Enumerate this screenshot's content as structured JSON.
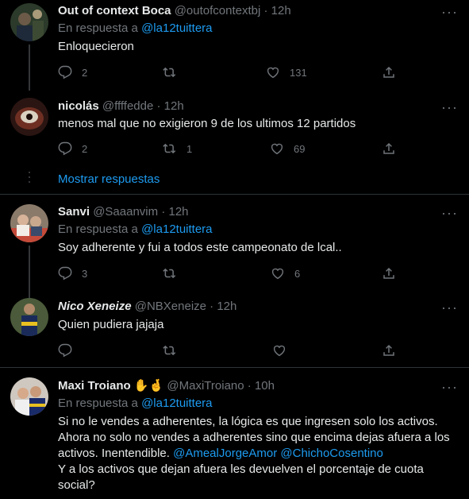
{
  "tweets": [
    {
      "name": "Out of context Boca",
      "handle": "@outofcontextbj",
      "time": "12h",
      "reply_prefix": "En respuesta a",
      "reply_to": "@la12tuittera",
      "text": "Enloquecieron",
      "replies": "2",
      "retweets": "",
      "likes": "131"
    },
    {
      "name": "nicolás",
      "handle": "@ffffedde",
      "time": "12h",
      "text": "menos mal que no exigieron 9 de los ultimos 12 partidos",
      "replies": "2",
      "retweets": "1",
      "likes": "69"
    },
    {
      "name": "Sanvi",
      "handle": "@Saaanvim",
      "time": "12h",
      "reply_prefix": "En respuesta a",
      "reply_to": "@la12tuittera",
      "text": "Soy adherente y fui a todos este campeonato de lcal..",
      "replies": "3",
      "retweets": "",
      "likes": "6"
    },
    {
      "name": "Nico Xeneize",
      "handle": "@NBXeneize",
      "time": "12h",
      "text": "Quien pudiera jajaja",
      "replies": "",
      "retweets": "",
      "likes": ""
    },
    {
      "name": "Maxi Troiano",
      "name_emoji": "✋🤞",
      "handle": "@MaxiTroiano",
      "time": "10h",
      "reply_prefix": "En respuesta a",
      "reply_to": "@la12tuittera",
      "text_line1": "Si no le vendes a adherentes, la lógica es que ingresen solo los activos.",
      "text_line2": "Ahora no solo no vendes a adherentes sino que encima dejas afuera a los",
      "text_line3_prefix": "activos. Inentendible.",
      "mention1": "@AmealJorgeAmor",
      "mention2": "@ChichoCosentino",
      "text_line4": "Y a los activos que dejan afuera les devuelven el porcentaje de cuota",
      "text_line5": "social?"
    }
  ],
  "show_replies_label": "Mostrar respuestas",
  "separator": "·",
  "more_glyph": "···",
  "colors": {
    "background": "#000000",
    "text": "#e7e9ea",
    "muted": "#71767b",
    "link": "#1d9bf0",
    "divider": "#2f3336"
  }
}
